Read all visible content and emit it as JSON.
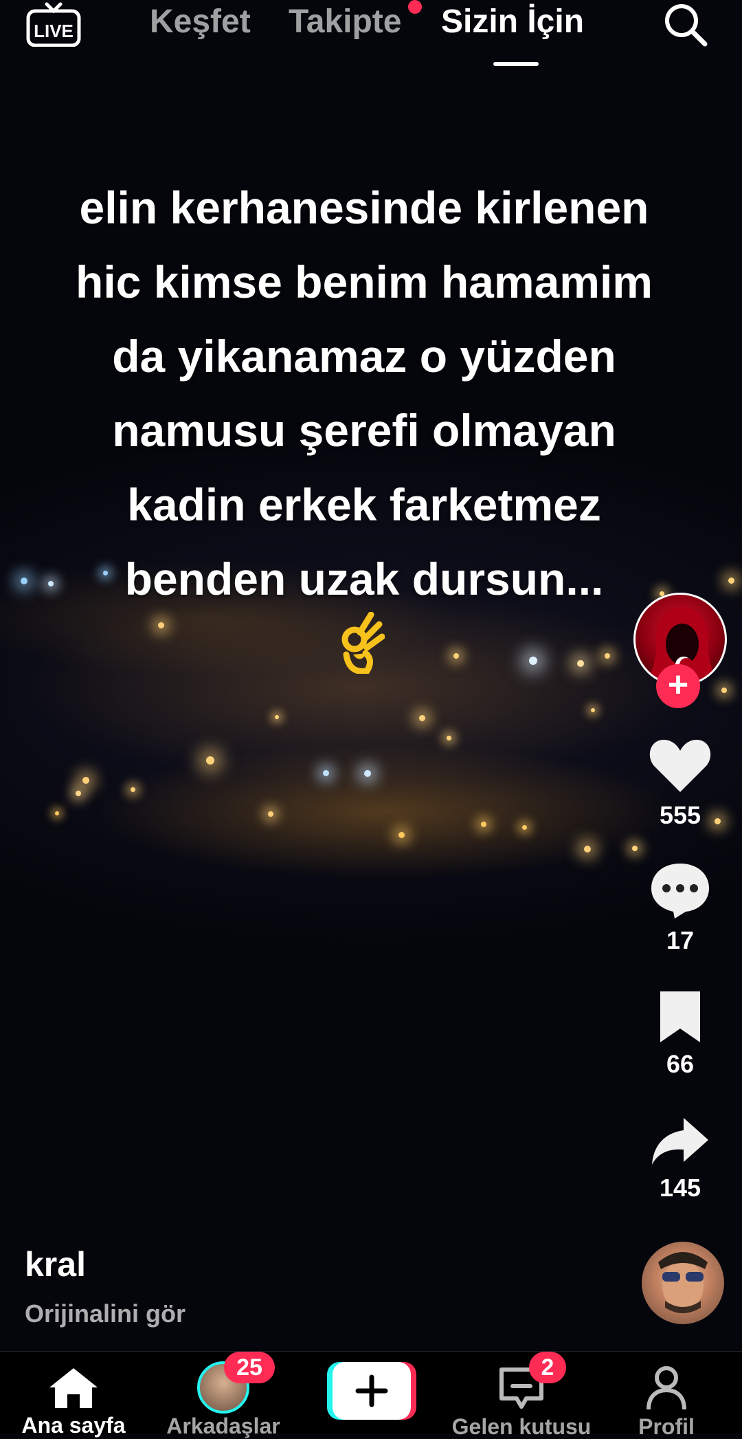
{
  "top_nav": {
    "live_label": "LIVE",
    "tabs": [
      {
        "label": "Keşfet",
        "active": false
      },
      {
        "label": "Takipte",
        "active": false,
        "has_dot": true
      },
      {
        "label": "Sizin İçin",
        "active": true
      }
    ]
  },
  "video": {
    "caption": "elin kerhanesinde kirlenen\nhic kimse benim hamamim\nda yikanamaz o yüzden\nnamusu şerefi olmayan\nkadin erkek farketmez\nbenden uzak dursun...",
    "emoji": "👌"
  },
  "actions": {
    "likes": "555",
    "comments": "17",
    "saves": "66",
    "shares": "145"
  },
  "post_info": {
    "author": "kral",
    "see_original": "Orijinalini gör"
  },
  "bottom_nav": {
    "items": [
      {
        "label": "Ana sayfa",
        "active": true
      },
      {
        "label": "Arkadaşlar",
        "badge": "25"
      },
      {
        "label": "",
        "type": "create"
      },
      {
        "label": "Gelen kutusu",
        "badge": "2"
      },
      {
        "label": "Profil"
      }
    ]
  },
  "colors": {
    "accent": "#fe2c55",
    "cyan": "#25f4ee",
    "background": "#05060c"
  }
}
